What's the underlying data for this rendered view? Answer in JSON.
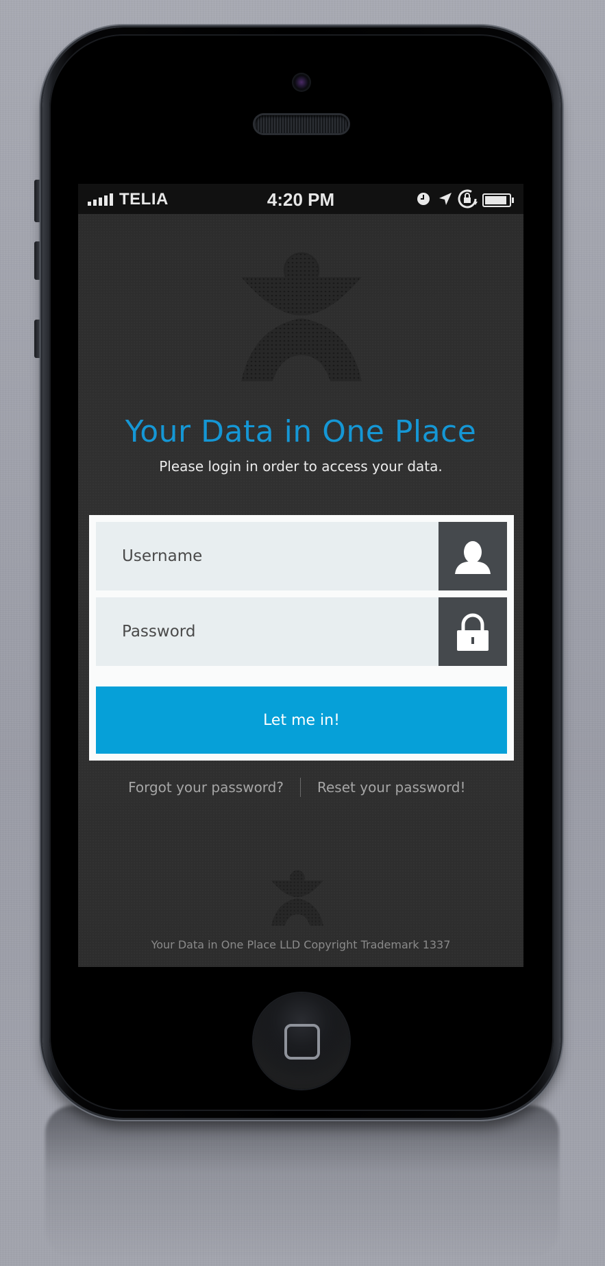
{
  "status_bar": {
    "carrier": "TELIA",
    "time": "4:20 PM",
    "signal_bars": 5,
    "battery_level": 0.9,
    "icons": [
      "alarm-icon",
      "location-arrow-icon",
      "rotation-lock-icon",
      "battery-icon"
    ]
  },
  "login": {
    "title": "Your Data in One Place",
    "subtitle": "Please login in order to access your data.",
    "username_placeholder": "Username",
    "password_placeholder": "Password",
    "submit_label": "Let me in!",
    "forgot_link": "Forgot your password?",
    "reset_link": "Reset your password!",
    "footer": "Your Data in One Place LLD Copyright Trademark 1337"
  },
  "colors": {
    "accent": "#06a0d8",
    "title": "#1597d5",
    "screen_background": "#2f2f2f",
    "panel_background": "#fafbfb",
    "field_background": "#e8eef0",
    "icon_box": "#45494d",
    "link": "#a6a6a6"
  }
}
